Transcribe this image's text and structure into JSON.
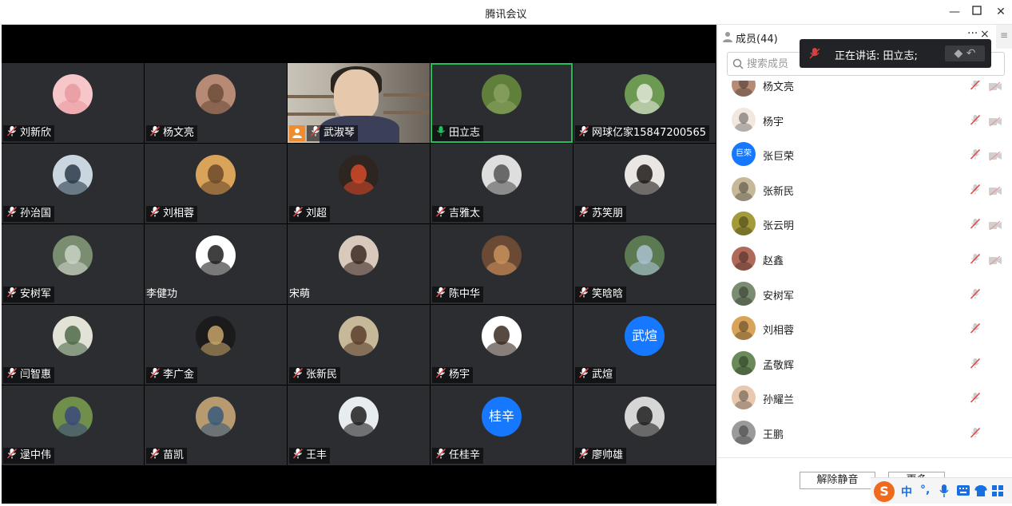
{
  "window": {
    "title": "腾讯会议"
  },
  "tiles": [
    {
      "name": "刘新欣",
      "muted": true,
      "avatar": {
        "bg": "#f7c6c9",
        "fg": "#e89aa0"
      }
    },
    {
      "name": "杨文亮",
      "muted": true,
      "avatar": {
        "bg": "#b78a76",
        "fg": "#6d4c3a"
      }
    },
    {
      "name": "武淑琴",
      "muted": true,
      "video": true
    },
    {
      "name": "田立志",
      "muted": false,
      "speaking": true,
      "avatar": {
        "bg": "#5f7f3a",
        "fg": "#8aa061"
      }
    },
    {
      "name": "网球亿家15847200565",
      "muted": true,
      "avatar": {
        "bg": "#6d9a53",
        "fg": "#e3e8d9"
      }
    },
    {
      "name": "孙治国",
      "muted": true,
      "avatar": {
        "bg": "#c9d6e0",
        "fg": "#2b3a4a"
      }
    },
    {
      "name": "刘相蓉",
      "muted": true,
      "avatar": {
        "bg": "#d9a35a",
        "fg": "#6b4a2a"
      }
    },
    {
      "name": "刘超",
      "muted": true,
      "avatar": {
        "bg": "#2f2520",
        "fg": "#d24a2a"
      }
    },
    {
      "name": "吉雅太",
      "muted": true,
      "avatar": {
        "bg": "#dedede",
        "fg": "#555555"
      }
    },
    {
      "name": "苏笑朋",
      "muted": true,
      "avatar": {
        "bg": "#e9e6e3",
        "fg": "#1f1a18"
      }
    },
    {
      "name": "安树军",
      "muted": true,
      "avatar": {
        "bg": "#7a8d70",
        "fg": "#c9d2c4"
      }
    },
    {
      "name": "李健功",
      "muted": false,
      "plain": true,
      "avatar": {
        "bg": "#ffffff",
        "fg": "#1f1f1f"
      }
    },
    {
      "name": "宋萌",
      "muted": false,
      "plain": true,
      "avatar": {
        "bg": "#d9c9bd",
        "fg": "#3a2a22"
      }
    },
    {
      "name": "陈中华",
      "muted": true,
      "avatar": {
        "bg": "#6b4a35",
        "fg": "#c9905a"
      }
    },
    {
      "name": "笑晗晗",
      "muted": true,
      "avatar": {
        "bg": "#5c7a52",
        "fg": "#a9c2d0"
      }
    },
    {
      "name": "闫智惠",
      "muted": true,
      "avatar": {
        "bg": "#e2e2d6",
        "fg": "#4f6a4a"
      }
    },
    {
      "name": "李广金",
      "muted": true,
      "avatar": {
        "bg": "#1b1b1b",
        "fg": "#c7a36a"
      }
    },
    {
      "name": "张新民",
      "muted": true,
      "avatar": {
        "bg": "#c6b99a",
        "fg": "#5a3e2b"
      }
    },
    {
      "name": "杨宇",
      "muted": true,
      "avatar": {
        "bg": "#ffffff",
        "fg": "#3a2a22"
      }
    },
    {
      "name": "武煊",
      "muted": true,
      "avatar_text": "武煊"
    },
    {
      "name": "逯中伟",
      "muted": true,
      "avatar": {
        "bg": "#6f8f4a",
        "fg": "#3a4a7a"
      }
    },
    {
      "name": "苗凯",
      "muted": true,
      "avatar": {
        "bg": "#b79a6f",
        "fg": "#3a5a7a"
      }
    },
    {
      "name": "王丰",
      "muted": true,
      "avatar": {
        "bg": "#e7ecef",
        "fg": "#202020"
      }
    },
    {
      "name": "任桂辛",
      "muted": true,
      "avatar_text": "桂辛"
    },
    {
      "name": "廖帅雄",
      "muted": true,
      "avatar": {
        "bg": "#d6d6d6",
        "fg": "#1f1f1f"
      }
    }
  ],
  "panel": {
    "title": "成员(44)",
    "more": "···",
    "close": "×",
    "menu": "≡",
    "search_placeholder": "搜索成员",
    "speaking_label": "正在讲话: 田立志;",
    "members": [
      {
        "name": "杨文亮",
        "avatar": {
          "bg": "#b78a76"
        },
        "video_off": true
      },
      {
        "name": "杨宇",
        "avatar": {
          "bg": "#f2e8e0"
        },
        "video_off": true
      },
      {
        "name": "张巨荣",
        "avatar_text": "巨荣",
        "video_off": true
      },
      {
        "name": "张新民",
        "avatar": {
          "bg": "#c6b99a"
        },
        "video_off": true
      },
      {
        "name": "张云明",
        "avatar": {
          "bg": "#a39a3a"
        },
        "video_off": true
      },
      {
        "name": "赵鑫",
        "avatar": {
          "bg": "#b06a5a"
        },
        "video_off": true
      },
      {
        "name": "安树军",
        "avatar": {
          "bg": "#7a8d70"
        },
        "video_off": false
      },
      {
        "name": "刘相蓉",
        "avatar": {
          "bg": "#d9a35a"
        },
        "video_off": false
      },
      {
        "name": "孟敬辉",
        "avatar": {
          "bg": "#6a8a5a"
        },
        "video_off": false
      },
      {
        "name": "孙耀兰",
        "avatar": {
          "bg": "#e8c9b0"
        },
        "video_off": false
      },
      {
        "name": "王鹏",
        "avatar": {
          "bg": "#9a9a9a"
        },
        "video_off": false
      }
    ],
    "footer": {
      "unmute_all": "解除静音",
      "more_btn": "更多"
    }
  },
  "ime": {
    "logo": "S",
    "lang": "中"
  }
}
